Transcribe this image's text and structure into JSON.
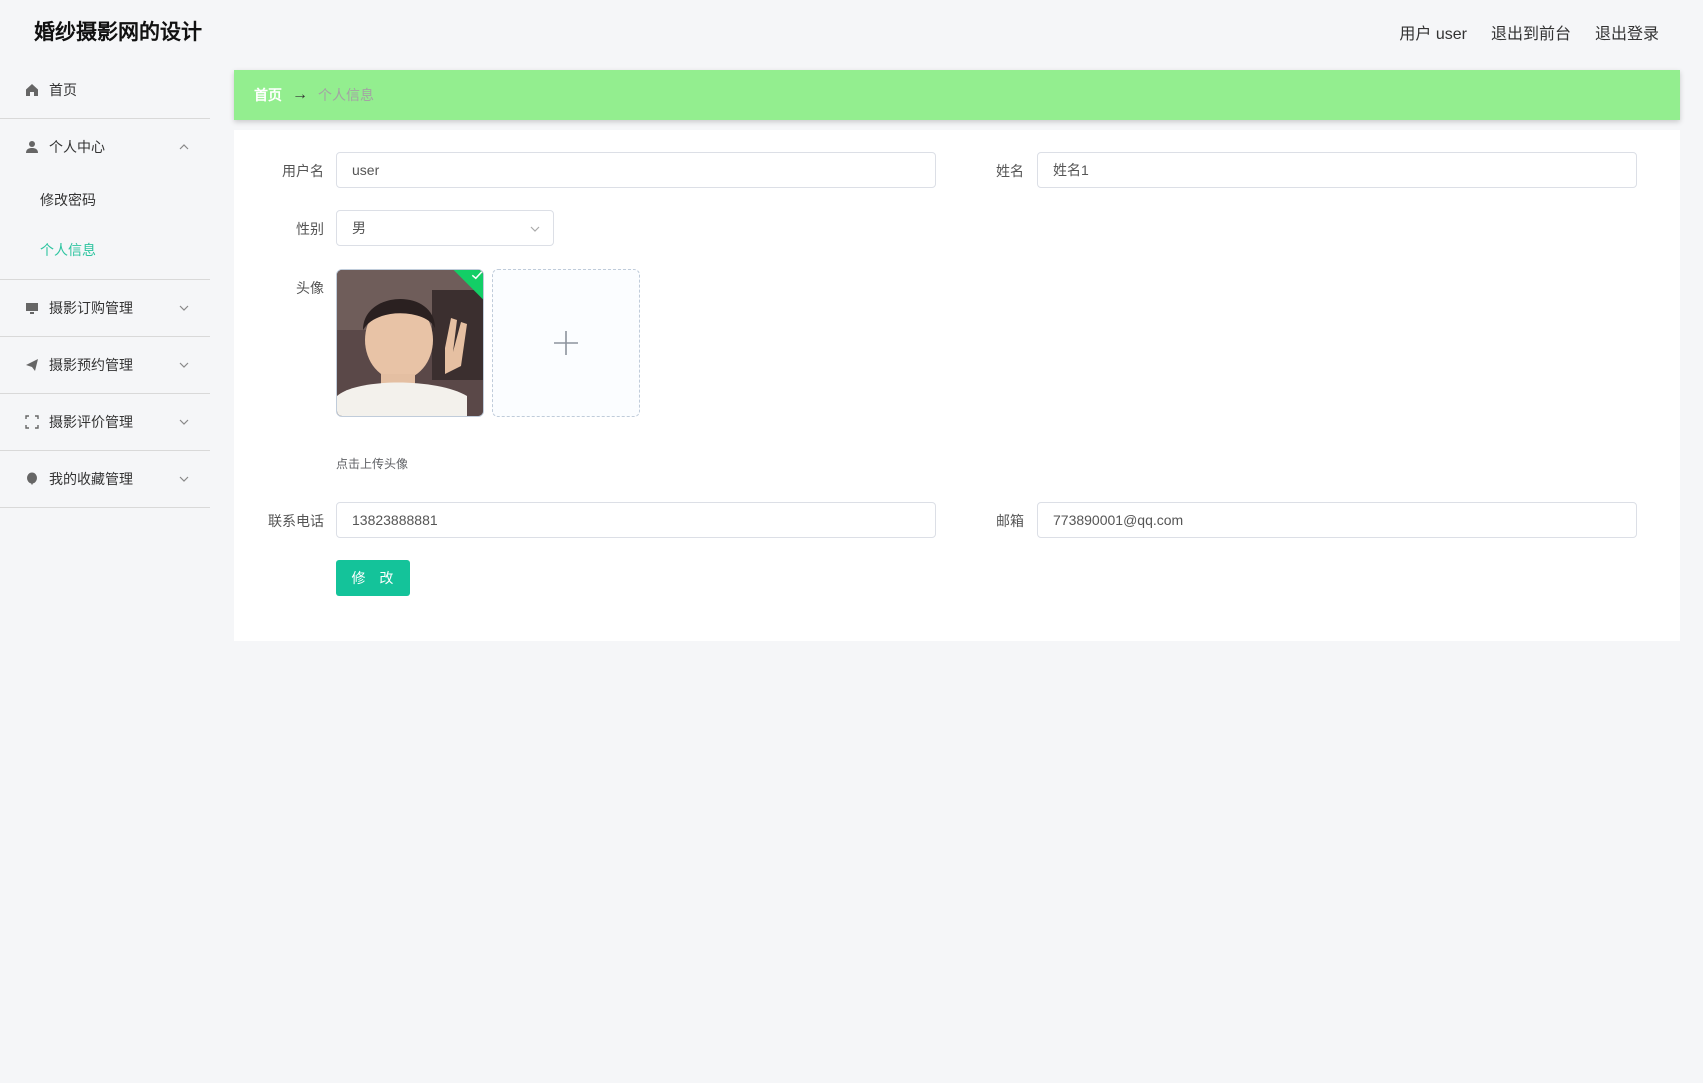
{
  "header": {
    "title": "婚纱摄影网的设计",
    "user_label": "用户 user",
    "front_link": "退出到前台",
    "logout_link": "退出登录"
  },
  "sidebar": {
    "items": [
      {
        "label": "首页",
        "icon": "home-icon"
      },
      {
        "label": "个人中心",
        "icon": "user-icon",
        "expanded": true,
        "children": [
          {
            "label": "修改密码"
          },
          {
            "label": "个人信息",
            "active": true
          }
        ]
      },
      {
        "label": "摄影订购管理",
        "icon": "monitor-icon"
      },
      {
        "label": "摄影预约管理",
        "icon": "send-icon"
      },
      {
        "label": "摄影评价管理",
        "icon": "fullscreen-icon"
      },
      {
        "label": "我的收藏管理",
        "icon": "balloon-icon"
      }
    ]
  },
  "breadcrumb": {
    "home": "首页",
    "arrow": "→",
    "current": "个人信息"
  },
  "form": {
    "username_label": "用户名",
    "username_value": "user",
    "name_label": "姓名",
    "name_value": "姓名1",
    "gender_label": "性别",
    "gender_value": "男",
    "avatar_label": "头像",
    "upload_tip": "点击上传头像",
    "phone_label": "联系电话",
    "phone_value": "13823888881",
    "email_label": "邮箱",
    "email_value": "773890001@qq.com",
    "submit_label": "修 改"
  },
  "colors": {
    "accent": "#14c39a",
    "active_menu": "#2ec4a0",
    "breadcrumb_bg": "#93ee8f"
  }
}
